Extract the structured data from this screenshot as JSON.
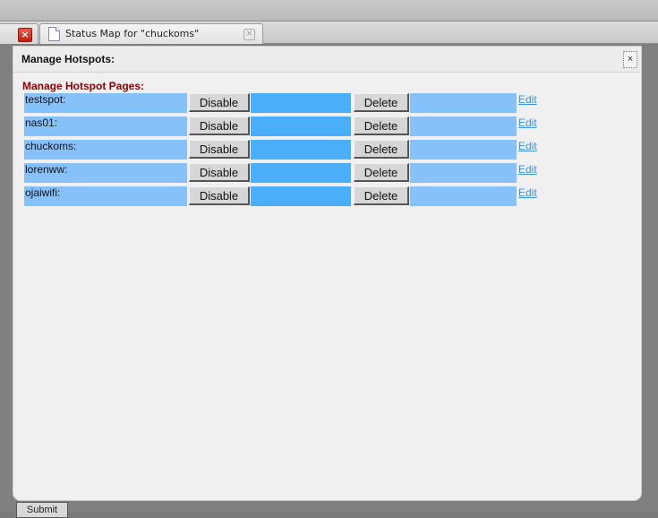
{
  "browser": {
    "active_tab_title": "Status Map for \"chuckoms\"",
    "prev_tab_close_glyph": "×",
    "tab_close_glyph": "×"
  },
  "page_behind": {
    "button_label": "Submit"
  },
  "modal": {
    "title": "Manage Hotspots:",
    "close_glyph": "×",
    "section_title": "Manage Hotspot Pages:",
    "rows": [
      {
        "name": "testspot:",
        "disable_label": "Disable",
        "delete_label": "Delete",
        "edit_label": "Edit"
      },
      {
        "name": "nas01:",
        "disable_label": "Disable",
        "delete_label": "Delete",
        "edit_label": "Edit"
      },
      {
        "name": "chuckoms:",
        "disable_label": "Disable",
        "delete_label": "Delete",
        "edit_label": "Edit"
      },
      {
        "name": "lorenww:",
        "disable_label": "Disable",
        "delete_label": "Delete",
        "edit_label": "Edit"
      },
      {
        "name": "ojaiwifi:",
        "disable_label": "Disable",
        "delete_label": "Delete",
        "edit_label": "Edit"
      }
    ]
  },
  "colors": {
    "row_light": "#86c1f9",
    "row_mid": "#4aaef9",
    "section_title": "#8b0000",
    "link": "#3a8fd6"
  },
  "icons": {
    "tab_close": "close-icon",
    "page": "page-icon",
    "modal_close": "close-icon"
  }
}
